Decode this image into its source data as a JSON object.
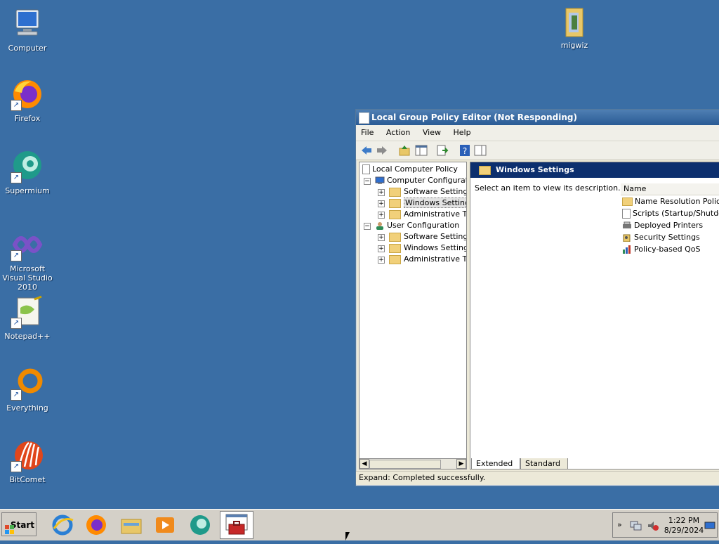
{
  "desktop": {
    "icons": [
      {
        "label": "Computer",
        "icon": "computer-icon"
      },
      {
        "label": "Firefox",
        "icon": "firefox-icon"
      },
      {
        "label": "Supermium",
        "icon": "supermium-icon"
      },
      {
        "label": "Microsoft Visual Studio 2010",
        "icon": "visual-studio-icon"
      },
      {
        "label": "Notepad++",
        "icon": "notepadpp-icon"
      },
      {
        "label": "Everything",
        "icon": "everything-icon"
      },
      {
        "label": "BitComet",
        "icon": "bitcomet-icon"
      },
      {
        "label": "migwiz",
        "icon": "folder-icon"
      }
    ]
  },
  "window": {
    "title": "Local Group Policy Editor (Not Responding)",
    "menu": [
      "File",
      "Action",
      "View",
      "Help"
    ],
    "tree": {
      "root": "Local Computer Policy",
      "items": [
        {
          "label": "Computer Configuratio",
          "expander": "−"
        },
        {
          "label": "Software Settings",
          "expander": "+"
        },
        {
          "label": "Windows Settings",
          "expander": "+"
        },
        {
          "label": "Administrative Tem",
          "expander": "+"
        },
        {
          "label": "User Configuration",
          "expander": "−"
        },
        {
          "label": "Software Settings",
          "expander": "+"
        },
        {
          "label": "Windows Settings",
          "expander": "+"
        },
        {
          "label": "Administrative Tem",
          "expander": "+"
        }
      ]
    },
    "right_pane": {
      "header": "Windows Settings",
      "description": "Select an item to view its description.",
      "list_header": "Name",
      "items": [
        "Name Resolution Policy",
        "Scripts (Startup/Shutdown)",
        "Deployed Printers",
        "Security Settings",
        "Policy-based QoS"
      ]
    },
    "tabs": [
      "Extended",
      "Standard"
    ],
    "status": "Expand:  Completed successfully."
  },
  "taskbar": {
    "start_label": "Start",
    "pinned": [
      "internet-explorer-icon",
      "firefox-icon",
      "explorer-icon",
      "media-player-icon",
      "supermium-icon",
      "policy-editor-icon"
    ],
    "clock_time": "1:22 PM",
    "clock_date": "8/29/2024",
    "tray_chevron": "»"
  }
}
